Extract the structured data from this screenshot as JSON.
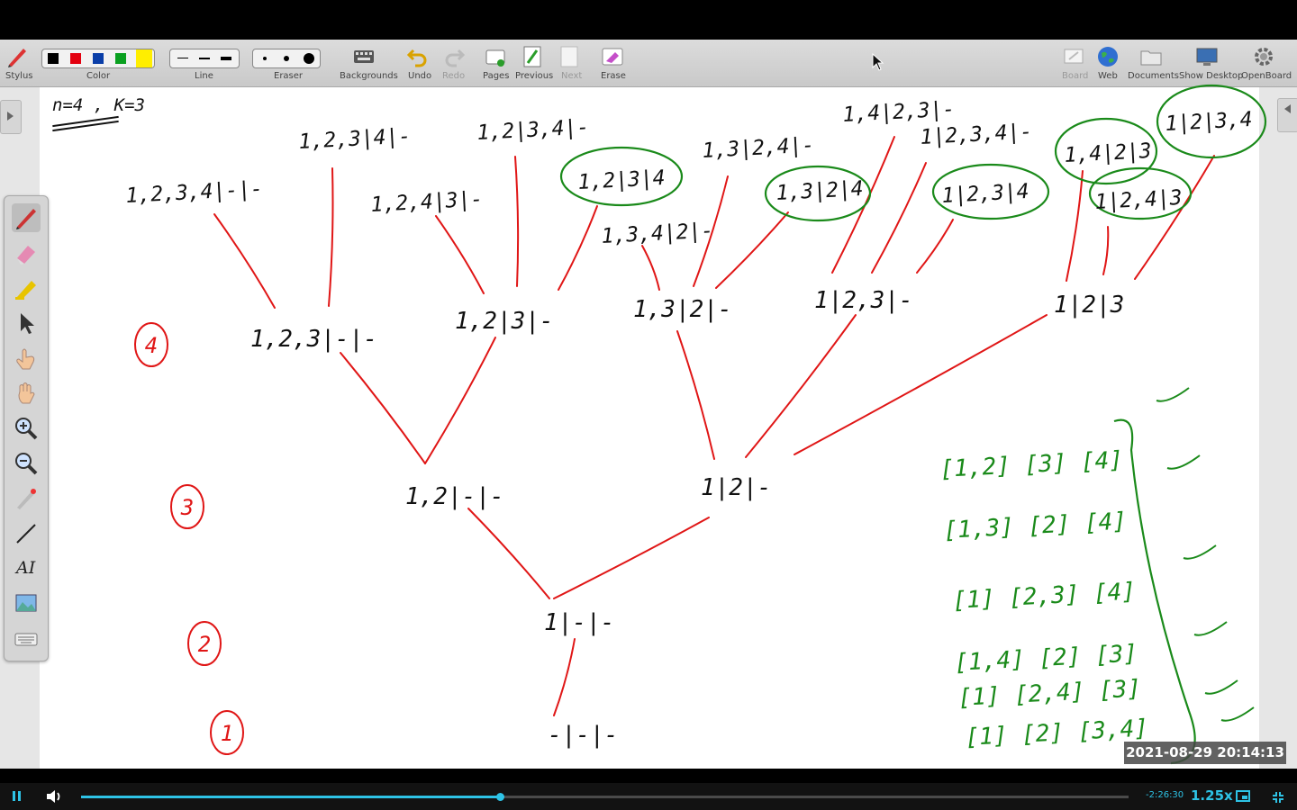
{
  "toolbar": {
    "stylus": "Stylus",
    "color": "Color",
    "line": "Line",
    "eraser": "Eraser",
    "backgrounds": "Backgrounds",
    "undo": "Undo",
    "redo": "Redo",
    "pages": "Pages",
    "previous": "Previous",
    "next": "Next",
    "erase": "Erase",
    "board": "Board",
    "web": "Web",
    "documents": "Documents",
    "show_desktop": "Show Desktop",
    "openboard": "OpenBoard",
    "colors": [
      "#000000",
      "#e3000f",
      "#0a3ea8",
      "#0aa020",
      "#ffee00"
    ]
  },
  "palette": {
    "tools": [
      "pen-icon",
      "eraser-icon",
      "marker-icon",
      "selector-icon",
      "interact-icon",
      "hand-icon",
      "zoom-in-icon",
      "zoom-out-icon",
      "laser-pointer-icon",
      "line-icon",
      "text-icon",
      "capture-icon",
      "keyboard-icon"
    ],
    "text_tool_glyph": "AI"
  },
  "whiteboard": {
    "header": "n=4 , K=3",
    "ink": {
      "black": "#111111",
      "red": "#e01616",
      "green": "#1a8a1a"
    },
    "level_labels": [
      "1",
      "2",
      "3",
      "4"
    ],
    "tree": {
      "root": "-|-|-",
      "level2": "1|-|-",
      "level3": [
        "1,2|-|-",
        "1|2|-"
      ],
      "level4": [
        "1,2,3|-|-",
        "1,2|3|-",
        "1,3|2|-",
        "1|2,3|-",
        "1|2|3"
      ],
      "leaves": [
        "1,2,3,4|-|-",
        "1,2,3|4|-",
        "1,2,4|3|-",
        "1,2|3,4|-",
        "1,2|3|4",
        "1,3,4|2|-",
        "1,3|2,4|-",
        "1,3|2|4",
        "1,4|2,3|-",
        "1|2,3,4|-",
        "1|2,3|4",
        "1,4|2|3",
        "1|2,4|3",
        "1|2|3,4"
      ]
    },
    "partitions": [
      "[1,2] [3] [4]",
      "[1,3] [2] [4]",
      "[1] [2,3] [4]",
      "[1,4] [2] [3]",
      "[1] [2,4] [3]",
      "[1] [2] [3,4]"
    ]
  },
  "player": {
    "remaining": "-2:26:30",
    "speed": "1.25x",
    "progress": 0.4,
    "timestamp": "2021-08-29  20:14:13"
  }
}
